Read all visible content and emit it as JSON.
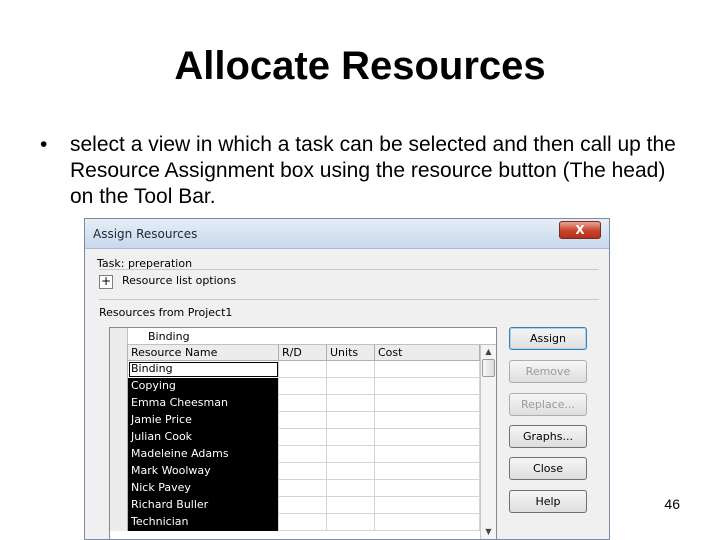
{
  "slide": {
    "title": "Allocate Resources",
    "bullet_symbol": "•",
    "bullet_text": "select a view in which a task can be selected and then call up the Resource Assignment box using the resource button (The head) on the Tool Bar.",
    "page_number": "46"
  },
  "dialog": {
    "title": "Assign Resources",
    "close_label": "X",
    "task_label": "Task: preperation",
    "expand_label": "+",
    "options_label": "Resource list options",
    "resources_label": "Resources from Project1",
    "edit_value": "Binding",
    "columns": [
      "Resource Name",
      "R/D",
      "Units",
      "Cost"
    ],
    "rows": [
      {
        "name": "Binding",
        "rd": "",
        "units": "",
        "cost": ""
      },
      {
        "name": "Copying",
        "rd": "",
        "units": "",
        "cost": ""
      },
      {
        "name": "Emma Cheesman",
        "rd": "",
        "units": "",
        "cost": ""
      },
      {
        "name": "Jamie Price",
        "rd": "",
        "units": "",
        "cost": ""
      },
      {
        "name": "Julian Cook",
        "rd": "",
        "units": "",
        "cost": ""
      },
      {
        "name": "Madeleine Adams",
        "rd": "",
        "units": "",
        "cost": ""
      },
      {
        "name": "Mark Woolway",
        "rd": "",
        "units": "",
        "cost": ""
      },
      {
        "name": "Nick Pavey",
        "rd": "",
        "units": "",
        "cost": ""
      },
      {
        "name": "Richard Buller",
        "rd": "",
        "units": "",
        "cost": ""
      },
      {
        "name": "Technician",
        "rd": "",
        "units": "",
        "cost": ""
      }
    ],
    "buttons": {
      "assign": "Assign",
      "remove": "Remove",
      "replace": "Replace...",
      "graphs": "Graphs...",
      "close": "Close",
      "help": "Help"
    },
    "scroll_up_glyph": "▲",
    "scroll_down_glyph": "▼"
  }
}
